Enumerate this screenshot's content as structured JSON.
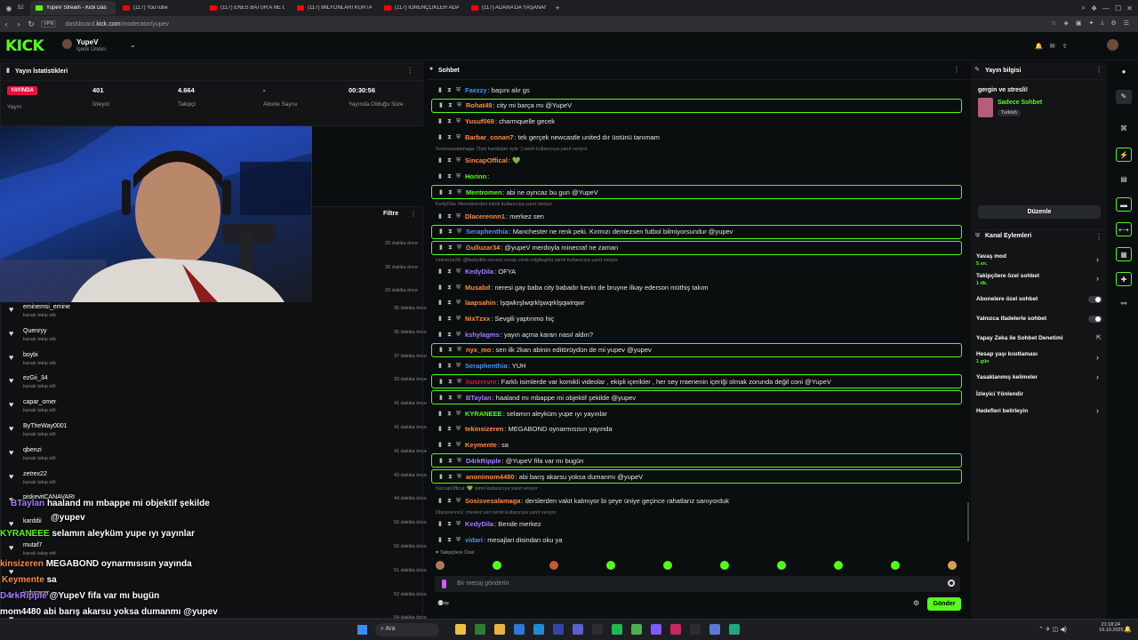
{
  "browser": {
    "tab_count": "52",
    "tabs": [
      {
        "title": "YupeV Stream - Kick Das",
        "icon": "kick-favicon",
        "active": true
      },
      {
        "title": "(117) YouTube",
        "icon": "youtube-favicon"
      },
      {
        "title": "(117) ENES BATUR'A NE OLDU",
        "icon": "youtube-favicon"
      },
      {
        "title": "(117) MİLYONLARI KURTARAN",
        "icon": "youtube-favicon"
      },
      {
        "title": "(117) İÖRENÇLİKLER ADA",
        "icon": "youtube-favicon"
      },
      {
        "title": "(117) ADANA'DA YAŞANAN",
        "icon": "youtube-favicon"
      }
    ],
    "url_prefix": "dashboard.",
    "url_domain": "kick.com",
    "url_path": "/moderator/yupev"
  },
  "header": {
    "logo": "KICK",
    "channel_name": "YupeV",
    "channel_role": "İçerik Üretici"
  },
  "stats_panel": {
    "title": "Yayın İstatistikleri",
    "live_badge": "YAYINDA",
    "live_label": "Yayın",
    "viewers_value": "401",
    "viewers_label": "İzleyici",
    "followers_value": "4.664",
    "followers_label": "Takipçi",
    "subs_value": "-",
    "subs_label": "Abone Sayısı",
    "duration_value": "00:30:56",
    "duration_label": "Yayında Olduğu Süre"
  },
  "activity_panel": {
    "filter_label": "Filtre",
    "times_top": [
      "29 dakika önce",
      "30 dakika önce",
      "33 dakika önce"
    ],
    "followers": [
      {
        "name": "eminemsi_emine",
        "sub": "kanalı takip etti",
        "time": "35 dakika önce"
      },
      {
        "name": "Quenryy",
        "sub": "kanalı takip etti",
        "time": "35 dakika önce"
      },
      {
        "name": "boybi",
        "sub": "kanalı takip etti",
        "time": "37 dakika önce"
      },
      {
        "name": "ezGii_34",
        "sub": "kanalı takip etti",
        "time": "39 dakika önce"
      },
      {
        "name": "capar_omer",
        "sub": "kanalı takip etti",
        "time": "41 dakika önce"
      },
      {
        "name": "ByTheWay0001",
        "sub": "kanalı takip etti",
        "time": "41 dakika önce"
      },
      {
        "name": "qbenzi",
        "sub": "kanalı takip etti",
        "time": "41 dakika önce"
      },
      {
        "name": "zetrex22",
        "sub": "kanalı takip etti",
        "time": "43 dakika önce"
      },
      {
        "name": "piskevitCANAVARI",
        "sub": "",
        "time": "44 dakika önce"
      },
      {
        "name": "karddii",
        "sub": "",
        "time": "50 dakika önce"
      },
      {
        "name": "mutaf7",
        "sub": "kanalı takip etti",
        "time": "50 dakika önce"
      },
      {
        "name": "",
        "sub": "",
        "time": "51 dakika önce"
      },
      {
        "name": "indurazer",
        "sub": "",
        "time": "52 dakika önce"
      },
      {
        "name": "",
        "sub": "",
        "time": "54 dakika önce"
      }
    ]
  },
  "overlay_chat": [
    {
      "user": "BTaylan",
      "text": "haaland mı mbappe mi objektif şekilde",
      "color": "#a77bff"
    },
    {
      "user": "",
      "text": "@yupev",
      "color": "#ffffff"
    },
    {
      "user": "KYRANEEE",
      "text": "selamın aleyküm yupe ıyı yayınlar",
      "color": "#53fc18"
    },
    {
      "user": "kinsizeren",
      "text": "MEGABOND oynarmısısın yayında",
      "color": "#ff8c3a"
    },
    {
      "user": "Keymente",
      "text": "sa",
      "color": "#ff8c3a"
    },
    {
      "user": "D4rkRipple",
      "text": "@YupeV fifa var mı bugün",
      "color": "#a77bff"
    },
    {
      "user": "mom4480",
      "text": "abi barış akarsu yoksa dumanmı @yupev",
      "color": "#ffffff"
    },
    {
      "user": "vidari",
      "text": "mesajlari disindan oku ya",
      "color": "#4d8ef7"
    }
  ],
  "chat": {
    "title": "Sohbet",
    "messages": [
      {
        "user": "Faezzy",
        "text": "başını alır gs",
        "color": "#4d8ef7",
        "hl": false,
        "reply": ""
      },
      {
        "user": "Rohat49",
        "text": "city mi barça mı @YupeV",
        "color": "#ff8c3a",
        "hl": true,
        "reply": ""
      },
      {
        "user": "Yusuf069",
        "text": "charmquelle gecek",
        "color": "#ff8c3a",
        "hl": false,
        "reply": ""
      },
      {
        "user": "Barbar_conan7",
        "text": "tek gerçek newcastle united dır üstünü tanımam",
        "color": "#ff8c3a",
        "hl": false,
        "reply": ""
      },
      {
        "user": "SincapOffical",
        "text": "💚",
        "color": "#ff8c3a",
        "hl": false,
        "reply": "Sosisvesalamaga: Öyle kardeşim öyle :) isimli kullanıcıya yanıt veriyor"
      },
      {
        "user": "Horinn",
        "text": "",
        "color": "#53fc18",
        "hl": false,
        "reply": ""
      },
      {
        "user": "Mentromen",
        "text": "abi ne oyncaz bu gun @YupeV",
        "color": "#53fc18",
        "hl": true,
        "reply": ""
      },
      {
        "user": "Dlacerennn1",
        "text": "merkez sen",
        "color": "#ff8c3a",
        "hl": false,
        "reply": "KedyDila: Nereslisinden isimli kullanıcıya yanıt veriyor"
      },
      {
        "user": "Seraphenthia",
        "text": "Manchester ne renk peki. Kırmızı demezsen futbol bilmiyorsundur  @yupev",
        "color": "#4d8ef7",
        "hl": true,
        "reply": ""
      },
      {
        "user": "Gulluzar34",
        "text": "@yupeV merdoyla minecraf ne zaman",
        "color": "#ff8c3a",
        "hl": true,
        "reply": ""
      },
      {
        "user": "KedyDila",
        "text": "OFYA",
        "color": "#a77bff",
        "hl": false,
        "reply": "Universe26: @kedydila sorunu cevap verdi cnlgflugnlu isimli kullanıcıya yanıt veriyor"
      },
      {
        "user": "Musabd",
        "text": "neresi gay baba city babadır kevin de bruyne ilkay ederson müthiş takım",
        "color": "#ff8c3a",
        "hl": false,
        "reply": ""
      },
      {
        "user": "laapsahin",
        "text": "lşqwkrşlwqrklşwqrklşqwirqwr",
        "color": "#ff8c3a",
        "hl": false,
        "reply": ""
      },
      {
        "user": "NixTzxx",
        "text": "Sevgili yaptınmo hiç",
        "color": "#ff8c3a",
        "hl": false,
        "reply": ""
      },
      {
        "user": "kshylagms",
        "text": "yayın açma kararı nasıl aldın?",
        "color": "#a77bff",
        "hl": false,
        "reply": ""
      },
      {
        "user": "nyx_mo",
        "text": "sen ilk 2kan abinin editörüydün de mi yupev @yupev",
        "color": "#ff8c3a",
        "hl": true,
        "reply": ""
      },
      {
        "user": "Seraphenthia",
        "text": "YUH",
        "color": "#4d8ef7",
        "hl": false,
        "reply": ""
      },
      {
        "user": "husrrevre",
        "text": "Farklı isimlerde var komikli videolar , ekipli içerikler , her sey rraenenin içeriği olmak zorunda değil coni @YupeV",
        "color": "#e9113c",
        "hl": true,
        "reply": ""
      },
      {
        "user": "BTaylan",
        "text": "haaland mı mbappe mi objektif şekilde @yupev",
        "color": "#a77bff",
        "hl": true,
        "reply": ""
      },
      {
        "user": "KYRANEEE",
        "text": "selamın aleyküm yupe ıyı yayınlar",
        "color": "#53fc18",
        "hl": false,
        "reply": ""
      },
      {
        "user": "tekinsizeren",
        "text": "MEGABOND oynarmısısın yayında",
        "color": "#ff8c3a",
        "hl": false,
        "reply": ""
      },
      {
        "user": "Keymente",
        "text": "sa",
        "color": "#ff8c3a",
        "hl": false,
        "reply": ""
      },
      {
        "user": "D4rkRipple",
        "text": "@YupeV fifa var mı bugün",
        "color": "#a77bff",
        "hl": true,
        "reply": ""
      },
      {
        "user": "anonimom4480",
        "text": "abi barış akarsu yoksa dumanmı @yupeV",
        "color": "#ff8c3a",
        "hl": true,
        "reply": ""
      },
      {
        "user": "Sosisvesalamaga",
        "text": "derslerden vakit kalmıyor bi şeye üniye geçince rahatlarız sanıyorduk",
        "color": "#ff8c3a",
        "hl": false,
        "reply": "SincapOffical: 💚 isimli kullanıcıya yanıt veriyor"
      },
      {
        "user": "KedyDila",
        "text": "Bende merkez",
        "color": "#a77bff",
        "hl": false,
        "reply": "Dlacerennn1: merkez sen isimli kullanıcıya yanıt veriyor"
      },
      {
        "user": "vidari",
        "text": "mesajlari disindan oku ya",
        "color": "#4d8ef7",
        "hl": false,
        "reply": ""
      }
    ],
    "followers_only_label": "Takipçilere Özel",
    "input_placeholder": "Bir mesaj gönderin",
    "send_label": "Gönder"
  },
  "info_panel": {
    "title": "Yayın bilgisi",
    "stream_title": "gergin ve stresli!",
    "category": "Sadece Sohbet",
    "language": "Turkish",
    "edit_label": "Düzenle"
  },
  "actions_panel": {
    "title": "Kanal Eylemleri",
    "slow_mode": "Yavaş mod",
    "slow_mode_value": "5 sn.",
    "followers_chat": "Takipçilere özel sohbet",
    "followers_chat_value": "1 dk.",
    "subs_chat": "Abonelere özel sohbet",
    "emote_chat": "Yalnızca ifadelerle sohbet",
    "ai_moderation": "Yapay Zeka ile Sohbet Denetimi",
    "account_age": "Hesap yaşı kısıtlaması",
    "account_age_value": "1 gün",
    "banned_words": "Yasaklanmış kelimeler",
    "viewer_redirect": "İzleyici Yönlendir",
    "set_goals": "Hedefleri belirleyin"
  },
  "taskbar": {
    "search_label": "Ara",
    "time": "21:18:24",
    "date": "19.10.2025"
  }
}
